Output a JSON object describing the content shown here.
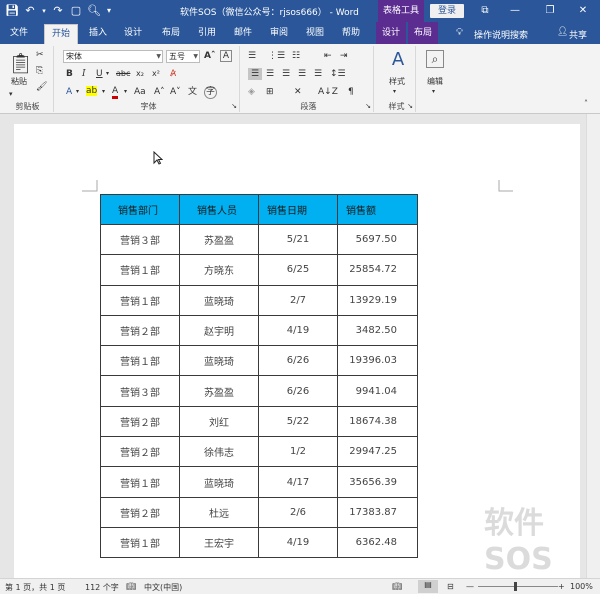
{
  "titlebar": {
    "doc_title": "软件SOS（微信公众号：rjsos666） - Word",
    "context_tab_group": "表格工具",
    "signin": "登录",
    "minimize": "—",
    "restore": "❐",
    "close": "✕"
  },
  "tabs": [
    {
      "label": "文件"
    },
    {
      "label": "开始"
    },
    {
      "label": "插入"
    },
    {
      "label": "设计"
    },
    {
      "label": "布局"
    },
    {
      "label": "引用"
    },
    {
      "label": "邮件"
    },
    {
      "label": "审阅"
    },
    {
      "label": "视图"
    },
    {
      "label": "帮助"
    },
    {
      "label": "设计"
    },
    {
      "label": "布局"
    }
  ],
  "tell_me": "操作说明搜索",
  "share": "共享",
  "ribbon": {
    "clipboard": {
      "paste_label": "粘贴",
      "group_label": "剪贴板"
    },
    "font": {
      "font_name": "宋体",
      "font_size": "五号",
      "group_label": "字体"
    },
    "paragraph": {
      "group_label": "段落"
    },
    "styles": {
      "label": "样式",
      "group_label": "样式"
    },
    "editing": {
      "label": "编辑"
    }
  },
  "table": {
    "headers": [
      "销售部门",
      "销售人员",
      "销售日期",
      "销售额"
    ],
    "rows": [
      [
        "营销３部",
        "苏盈盈",
        "5/21",
        "5697.50"
      ],
      [
        "营销１部",
        "方晓东",
        "6/25",
        "25854.72"
      ],
      [
        "营销１部",
        "蓝晓琦",
        "2/7",
        "13929.19"
      ],
      [
        "营销２部",
        "赵宇明",
        "4/19",
        "3482.50"
      ],
      [
        "营销１部",
        "蓝晓琦",
        "6/26",
        "19396.03"
      ],
      [
        "营销３部",
        "苏盈盈",
        "6/26",
        "9941.04"
      ],
      [
        "营销２部",
        "刘红",
        "5/22",
        "18674.38"
      ],
      [
        "营销２部",
        "徐伟志",
        "1/2",
        "29947.25"
      ],
      [
        "营销１部",
        "蓝晓琦",
        "4/17",
        "35656.39"
      ],
      [
        "营销２部",
        "杜远",
        "2/6",
        "17383.87"
      ],
      [
        "营销１部",
        "王宏宇",
        "4/19",
        "6362.48"
      ]
    ]
  },
  "watermark": "软件SOS",
  "status": {
    "page": "第 1 页，共 1 页",
    "words": "112 个字",
    "language": "中文(中国)",
    "zoom": "100%",
    "zoom_minus": "—",
    "zoom_plus": "+"
  },
  "colors": {
    "word_blue": "#2b579a",
    "table_tools_purple": "#5c2d91",
    "header_fill": "#00b0f0"
  }
}
